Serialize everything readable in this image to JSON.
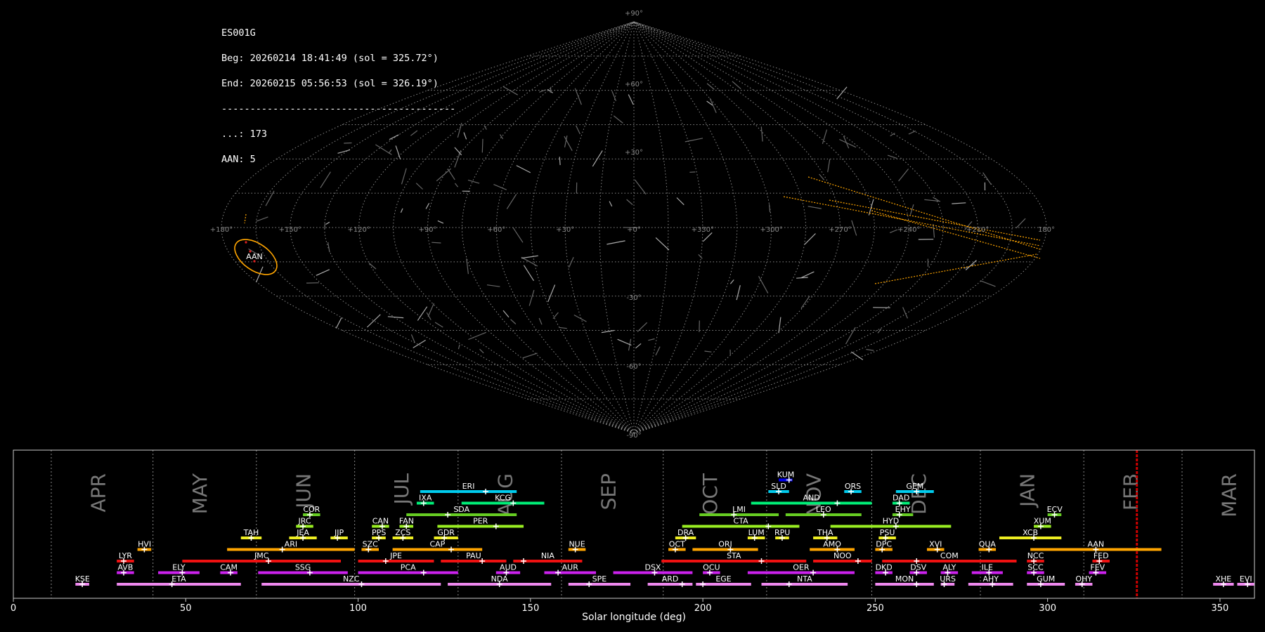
{
  "info": {
    "station": "ES001G",
    "begin": "Beg: 20260214 18:41:49 (sol = 325.72°)",
    "end": "End: 20260215 05:56:53 (sol = 326.19°)",
    "separator": "-----------------------------------------",
    "sporadic": "...: 173",
    "shower": "AAN: 5"
  },
  "sky_map": {
    "projection": "sinusoidal",
    "lon_labels": [
      "+180°",
      "+150°",
      "+120°",
      "+90°",
      "+60°",
      "+30°",
      "+0°",
      "+330°",
      "+300°",
      "+270°",
      "+240°",
      "+210°",
      "180°"
    ],
    "lat_labels": [
      "+90°",
      "+60°",
      "+30°",
      "-30°",
      "-60°",
      "-90°"
    ],
    "highlight_shower": "AAN",
    "highlight_color": "#ffa500"
  },
  "chart_data": {
    "type": "timeline",
    "xlabel": "Solar longitude (deg)",
    "xlim": [
      0,
      360
    ],
    "xticks": [
      0,
      50,
      100,
      150,
      200,
      250,
      300,
      350
    ],
    "current_sol": 325.9,
    "current_color": "#cc0000",
    "months": [
      {
        "name": "APR",
        "x": 11
      },
      {
        "name": "MAY",
        "x": 40.5
      },
      {
        "name": "JUN",
        "x": 70.5
      },
      {
        "name": "JUL",
        "x": 99
      },
      {
        "name": "AUG",
        "x": 129
      },
      {
        "name": "SEP",
        "x": 159
      },
      {
        "name": "OCT",
        "x": 188.5
      },
      {
        "name": "NOV",
        "x": 218.5
      },
      {
        "name": "DEC",
        "x": 249
      },
      {
        "name": "JAN",
        "x": 280.5
      },
      {
        "name": "FEB",
        "x": 310.5
      },
      {
        "name": "MAR",
        "x": 339
      }
    ],
    "showers": [
      {
        "name": "KUM",
        "row": 9,
        "start": 222,
        "end": 226,
        "peak": 225,
        "color": "#0000ee"
      },
      {
        "name": "ERI",
        "row": 8,
        "start": 118,
        "end": 146,
        "peak": 137,
        "color": "#00ccee"
      },
      {
        "name": "SLD",
        "row": 8,
        "start": 219,
        "end": 225,
        "peak": 222,
        "color": "#00ccee"
      },
      {
        "name": "ORS",
        "row": 8,
        "start": 241,
        "end": 246,
        "peak": 243,
        "color": "#00ccee"
      },
      {
        "name": "GEM",
        "row": 8,
        "start": 256,
        "end": 267,
        "peak": 262,
        "color": "#00ccee"
      },
      {
        "name": "IXA",
        "row": 7,
        "start": 117,
        "end": 122,
        "peak": 119,
        "color": "#00ee77"
      },
      {
        "name": "KCG",
        "row": 7,
        "start": 130,
        "end": 154,
        "peak": 145,
        "color": "#00ee77"
      },
      {
        "name": "AND",
        "row": 7,
        "start": 214,
        "end": 249,
        "peak": 239,
        "color": "#00ee77"
      },
      {
        "name": "DAD",
        "row": 7,
        "start": 255,
        "end": 260,
        "peak": 257,
        "color": "#00ee77"
      },
      {
        "name": "COR",
        "row": 6,
        "start": 84,
        "end": 89,
        "peak": 86,
        "color": "#66cc22"
      },
      {
        "name": "SDA",
        "row": 6,
        "start": 114,
        "end": 146,
        "peak": 126,
        "color": "#66cc22"
      },
      {
        "name": "LMI",
        "row": 6,
        "start": 199,
        "end": 222,
        "peak": 209,
        "color": "#66cc22"
      },
      {
        "name": "LEO",
        "row": 6,
        "start": 224,
        "end": 246,
        "peak": 235,
        "color": "#66cc22"
      },
      {
        "name": "EHY",
        "row": 6,
        "start": 255,
        "end": 261,
        "peak": 257,
        "color": "#66cc22"
      },
      {
        "name": "ECV",
        "row": 6,
        "start": 300,
        "end": 304,
        "peak": 302,
        "color": "#66cc22"
      },
      {
        "name": "JRC",
        "row": 5,
        "start": 82,
        "end": 87,
        "peak": 84,
        "color": "#99ee22"
      },
      {
        "name": "CAN",
        "row": 5,
        "start": 104,
        "end": 109,
        "peak": 107,
        "color": "#99ee22"
      },
      {
        "name": "FAN",
        "row": 5,
        "start": 112,
        "end": 116,
        "peak": 114,
        "color": "#99ee22"
      },
      {
        "name": "PER",
        "row": 5,
        "start": 123,
        "end": 148,
        "peak": 140,
        "color": "#99ee22"
      },
      {
        "name": "CTA",
        "row": 5,
        "start": 194,
        "end": 228,
        "peak": 219,
        "color": "#99ee22"
      },
      {
        "name": "HYD",
        "row": 5,
        "start": 237,
        "end": 272,
        "peak": 256,
        "color": "#99ee22"
      },
      {
        "name": "XUM",
        "row": 5,
        "start": 296,
        "end": 301,
        "peak": 298,
        "color": "#99ee22"
      },
      {
        "name": "TAH",
        "row": 4,
        "start": 66,
        "end": 72,
        "peak": 69,
        "color": "#eeee22"
      },
      {
        "name": "JEA",
        "row": 4,
        "start": 80,
        "end": 88,
        "peak": 84,
        "color": "#eeee22"
      },
      {
        "name": "JIP",
        "row": 4,
        "start": 92,
        "end": 97,
        "peak": 94,
        "color": "#eeee22"
      },
      {
        "name": "PPS",
        "row": 4,
        "start": 104,
        "end": 108,
        "peak": 106,
        "color": "#eeee22"
      },
      {
        "name": "ZCS",
        "row": 4,
        "start": 110,
        "end": 116,
        "peak": 113,
        "color": "#eeee22"
      },
      {
        "name": "GDR",
        "row": 4,
        "start": 122,
        "end": 129,
        "peak": 125,
        "color": "#eeee22"
      },
      {
        "name": "DRA",
        "row": 4,
        "start": 192,
        "end": 198,
        "peak": 195,
        "color": "#eeee22"
      },
      {
        "name": "LUM",
        "row": 4,
        "start": 213,
        "end": 218,
        "peak": 215,
        "color": "#eeee22"
      },
      {
        "name": "RPU",
        "row": 4,
        "start": 221,
        "end": 225,
        "peak": 223,
        "color": "#eeee22"
      },
      {
        "name": "THA",
        "row": 4,
        "start": 232,
        "end": 239,
        "peak": 236,
        "color": "#eeee22"
      },
      {
        "name": "PSU",
        "row": 4,
        "start": 251,
        "end": 256,
        "peak": 253,
        "color": "#eeee22"
      },
      {
        "name": "XCB",
        "row": 4,
        "start": 286,
        "end": 304,
        "peak": 296,
        "color": "#eeee22"
      },
      {
        "name": "HVI",
        "row": 3,
        "start": 36,
        "end": 40,
        "peak": 38,
        "color": "#ffa500"
      },
      {
        "name": "ARI",
        "row": 3,
        "start": 62,
        "end": 99,
        "peak": 78,
        "color": "#ffa500"
      },
      {
        "name": "SZC",
        "row": 3,
        "start": 101,
        "end": 106,
        "peak": 103,
        "color": "#ffa500"
      },
      {
        "name": "CAP",
        "row": 3,
        "start": 110,
        "end": 136,
        "peak": 127,
        "color": "#ffa500"
      },
      {
        "name": "NUE",
        "row": 3,
        "start": 161,
        "end": 166,
        "peak": 163,
        "color": "#ffa500"
      },
      {
        "name": "OCT",
        "row": 3,
        "start": 190,
        "end": 195,
        "peak": 192,
        "color": "#ffa500"
      },
      {
        "name": "ORI",
        "row": 3,
        "start": 197,
        "end": 216,
        "peak": 208,
        "color": "#ffa500"
      },
      {
        "name": "AMO",
        "row": 3,
        "start": 231,
        "end": 244,
        "peak": 239,
        "color": "#ffa500"
      },
      {
        "name": "DPC",
        "row": 3,
        "start": 250,
        "end": 255,
        "peak": 252,
        "color": "#ffa500"
      },
      {
        "name": "XVI",
        "row": 3,
        "start": 265,
        "end": 270,
        "peak": 268,
        "color": "#ffa500"
      },
      {
        "name": "QUA",
        "row": 3,
        "start": 280,
        "end": 285,
        "peak": 283,
        "color": "#ffa500"
      },
      {
        "name": "AAN",
        "row": 3,
        "start": 295,
        "end": 333,
        "peak": 314,
        "color": "#ffa500"
      },
      {
        "name": "LYR",
        "row": 2,
        "start": 30,
        "end": 35,
        "peak": 32,
        "color": "#ee1111"
      },
      {
        "name": "JMC",
        "row": 2,
        "start": 49,
        "end": 95,
        "peak": 74,
        "color": "#ee1111"
      },
      {
        "name": "JPE",
        "row": 2,
        "start": 100,
        "end": 122,
        "peak": 108,
        "color": "#ee1111"
      },
      {
        "name": "PAU",
        "row": 2,
        "start": 124,
        "end": 143,
        "peak": 136,
        "color": "#ee1111"
      },
      {
        "name": "NIA",
        "row": 2,
        "start": 145,
        "end": 165,
        "peak": 148,
        "color": "#ee1111"
      },
      {
        "name": "STA",
        "row": 2,
        "start": 188,
        "end": 230,
        "peak": 217,
        "color": "#ee1111"
      },
      {
        "name": "NOO",
        "row": 2,
        "start": 232,
        "end": 249,
        "peak": 245,
        "color": "#ee1111"
      },
      {
        "name": "COM",
        "row": 2,
        "start": 252,
        "end": 291,
        "peak": 262,
        "color": "#ee1111"
      },
      {
        "name": "NCC",
        "row": 2,
        "start": 294,
        "end": 299,
        "peak": 296,
        "color": "#ee1111"
      },
      {
        "name": "FED",
        "row": 2,
        "start": 313,
        "end": 318,
        "peak": 315,
        "color": "#ee1111"
      },
      {
        "name": "AVB",
        "row": 1,
        "start": 30,
        "end": 35,
        "peak": 32,
        "color": "#cc22ee"
      },
      {
        "name": "ELY",
        "row": 1,
        "start": 42,
        "end": 54,
        "peak": 49,
        "color": "#cc22ee"
      },
      {
        "name": "CAM",
        "row": 1,
        "start": 60,
        "end": 65,
        "peak": 63,
        "color": "#cc22ee"
      },
      {
        "name": "SSG",
        "row": 1,
        "start": 71,
        "end": 97,
        "peak": 86,
        "color": "#cc22ee"
      },
      {
        "name": "PCA",
        "row": 1,
        "start": 100,
        "end": 129,
        "peak": 119,
        "color": "#cc22ee"
      },
      {
        "name": "AUD",
        "row": 1,
        "start": 140,
        "end": 147,
        "peak": 143,
        "color": "#cc22ee"
      },
      {
        "name": "AUR",
        "row": 1,
        "start": 154,
        "end": 169,
        "peak": 158,
        "color": "#cc22ee"
      },
      {
        "name": "DSX",
        "row": 1,
        "start": 174,
        "end": 197,
        "peak": 186,
        "color": "#cc22ee"
      },
      {
        "name": "OCU",
        "row": 1,
        "start": 200,
        "end": 205,
        "peak": 202,
        "color": "#cc22ee"
      },
      {
        "name": "OER",
        "row": 1,
        "start": 213,
        "end": 244,
        "peak": 232,
        "color": "#cc22ee"
      },
      {
        "name": "DKD",
        "row": 1,
        "start": 250,
        "end": 255,
        "peak": 253,
        "color": "#cc22ee"
      },
      {
        "name": "DSV",
        "row": 1,
        "start": 260,
        "end": 265,
        "peak": 262,
        "color": "#cc22ee"
      },
      {
        "name": "ALY",
        "row": 1,
        "start": 269,
        "end": 274,
        "peak": 271,
        "color": "#cc22ee"
      },
      {
        "name": "ILE",
        "row": 1,
        "start": 278,
        "end": 287,
        "peak": 283,
        "color": "#cc22ee"
      },
      {
        "name": "SCC",
        "row": 1,
        "start": 294,
        "end": 299,
        "peak": 296,
        "color": "#cc22ee"
      },
      {
        "name": "FEV",
        "row": 1,
        "start": 312,
        "end": 317,
        "peak": 314,
        "color": "#cc22ee"
      },
      {
        "name": "KSE",
        "row": 0,
        "start": 18,
        "end": 22,
        "peak": 20,
        "color": "#ee88ee"
      },
      {
        "name": "ETA",
        "row": 0,
        "start": 30,
        "end": 66,
        "peak": 46,
        "color": "#ee88ee"
      },
      {
        "name": "NZC",
        "row": 0,
        "start": 72,
        "end": 124,
        "peak": 101,
        "color": "#ee88ee"
      },
      {
        "name": "NDA",
        "row": 0,
        "start": 126,
        "end": 156,
        "peak": 141,
        "color": "#ee88ee"
      },
      {
        "name": "SPE",
        "row": 0,
        "start": 161,
        "end": 179,
        "peak": 167,
        "color": "#ee88ee"
      },
      {
        "name": "ARD",
        "row": 0,
        "start": 184,
        "end": 197,
        "peak": 194,
        "color": "#ee88ee"
      },
      {
        "name": "EGE",
        "row": 0,
        "start": 198,
        "end": 214,
        "peak": 200,
        "color": "#ee88ee"
      },
      {
        "name": "NTA",
        "row": 0,
        "start": 217,
        "end": 242,
        "peak": 225,
        "color": "#ee88ee"
      },
      {
        "name": "MON",
        "row": 0,
        "start": 250,
        "end": 267,
        "peak": 262,
        "color": "#ee88ee"
      },
      {
        "name": "URS",
        "row": 0,
        "start": 269,
        "end": 273,
        "peak": 270,
        "color": "#ee88ee"
      },
      {
        "name": "AHY",
        "row": 0,
        "start": 277,
        "end": 290,
        "peak": 284,
        "color": "#ee88ee"
      },
      {
        "name": "GUM",
        "row": 0,
        "start": 294,
        "end": 305,
        "peak": 298,
        "color": "#ee88ee"
      },
      {
        "name": "OHY",
        "row": 0,
        "start": 308,
        "end": 313,
        "peak": 310,
        "color": "#ee88ee"
      },
      {
        "name": "XHE",
        "row": 0,
        "start": 348,
        "end": 354,
        "peak": 351,
        "color": "#ee88ee"
      },
      {
        "name": "EVI",
        "row": 0,
        "start": 355,
        "end": 360,
        "peak": 358,
        "color": "#ee88ee"
      }
    ]
  }
}
